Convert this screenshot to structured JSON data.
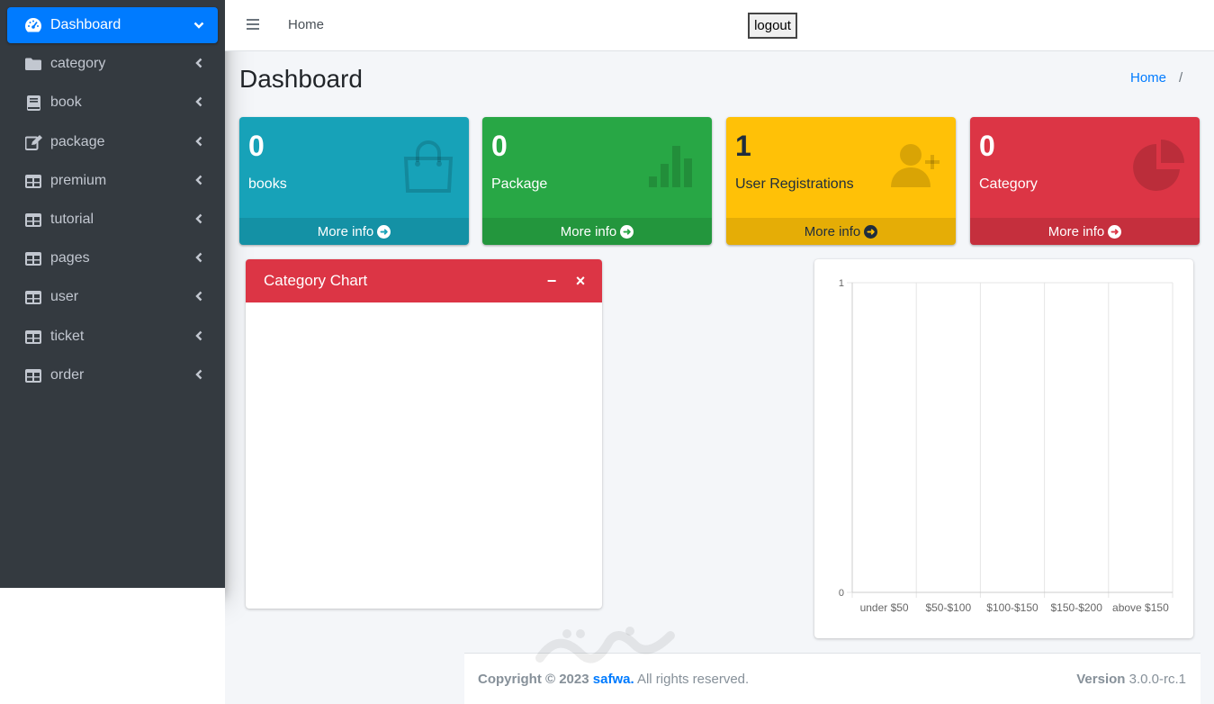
{
  "sidebar": {
    "items": [
      {
        "label": "Dashboard",
        "icon": "tachometer-icon"
      },
      {
        "label": "category",
        "icon": "folder-icon"
      },
      {
        "label": "book",
        "icon": "book-icon"
      },
      {
        "label": "package",
        "icon": "edit-icon"
      },
      {
        "label": "premium",
        "icon": "table-icon"
      },
      {
        "label": "tutorial",
        "icon": "table-icon"
      },
      {
        "label": "pages",
        "icon": "table-icon"
      },
      {
        "label": "user",
        "icon": "table-icon"
      },
      {
        "label": "ticket",
        "icon": "table-icon"
      },
      {
        "label": "order",
        "icon": "table-icon"
      }
    ]
  },
  "navbar": {
    "home": "Home",
    "logout": "logout"
  },
  "content_header": {
    "title": "Dashboard",
    "breadcrumb_home": "Home",
    "breadcrumb_sep": "/"
  },
  "boxes": [
    {
      "number": "0",
      "label": "books",
      "footer": "More info",
      "color": "#17a2b8",
      "icon": "shopping-bag-icon"
    },
    {
      "number": "0",
      "label": "Package",
      "footer": "More info",
      "color": "#28a745",
      "icon": "bar-chart-icon"
    },
    {
      "number": "1",
      "label": "User Registrations",
      "footer": "More info",
      "color": "#ffc107",
      "icon": "user-plus-icon"
    },
    {
      "number": "0",
      "label": "Category",
      "footer": "More info",
      "color": "#dc3545",
      "icon": "pie-chart-icon"
    }
  ],
  "category_card": {
    "title": "Category Chart",
    "minimize": "−",
    "close": "×"
  },
  "chart_data": {
    "type": "bar",
    "categories": [
      "under $50",
      "$50-$100",
      "$100-$150",
      "$150-$200",
      "above $150"
    ],
    "series": [
      {
        "values": [
          0,
          0,
          0,
          0,
          0
        ]
      }
    ],
    "ylim": [
      0,
      1
    ],
    "yticks": [
      "1",
      "0"
    ],
    "grid": true
  },
  "footer": {
    "copyright_prefix": "Copyright © 2023",
    "brand": "safwa.",
    "rights": "All rights reserved.",
    "version_label": "Version",
    "version": "3.0.0-rc.1"
  },
  "colors": {
    "sidebar": "#343a40",
    "active": "#007bff"
  }
}
